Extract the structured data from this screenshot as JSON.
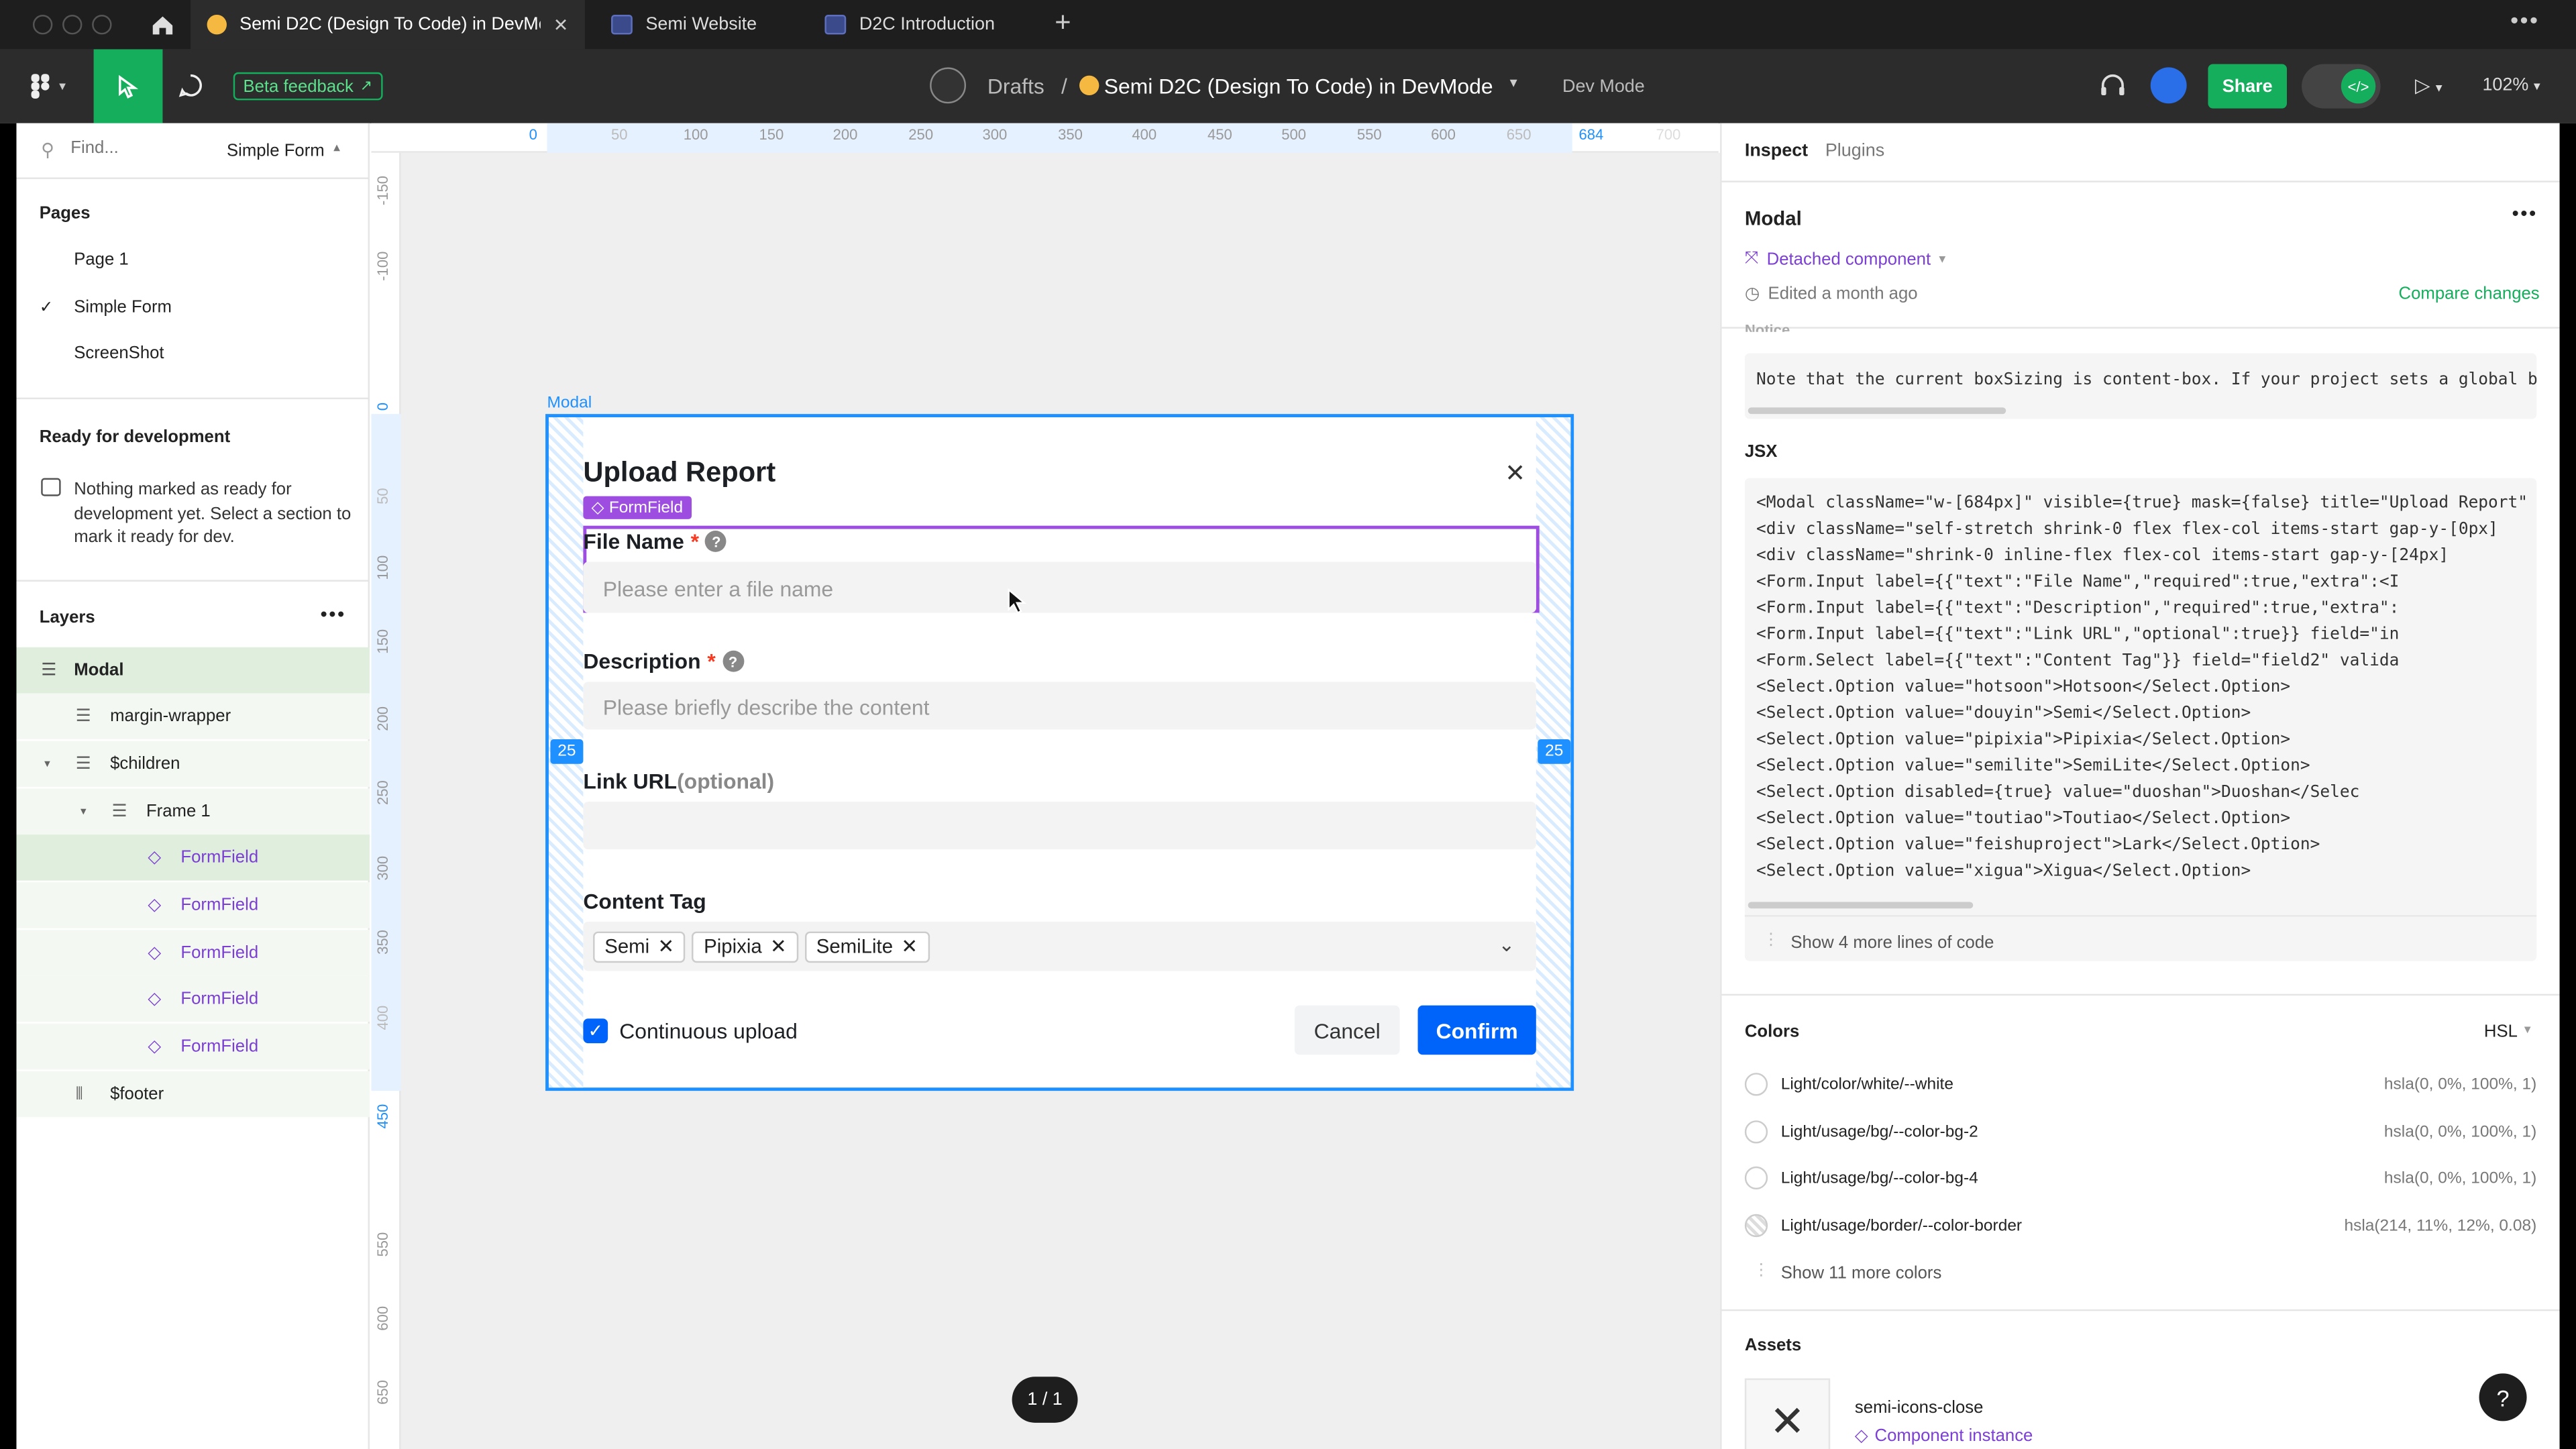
{
  "tabs": [
    {
      "label": "Semi D2C (Design To Code) in DevMod",
      "icon": "emoji-icon",
      "active": true
    },
    {
      "label": "Semi Website",
      "icon": "figma-file-icon",
      "active": false
    },
    {
      "label": "D2C Introduction",
      "icon": "figma-file-icon",
      "active": false
    }
  ],
  "toolbar": {
    "beta_feedback": "Beta feedback",
    "breadcrumb_root": "Drafts",
    "breadcrumb_sep": "/",
    "file_title": "Semi D2C (Design To Code) in DevMode",
    "mode": "Dev Mode",
    "share": "Share",
    "zoom": "102%"
  },
  "left_panel": {
    "search_placeholder": "Find...",
    "page_selector": "Simple Form",
    "pages_heading": "Pages",
    "pages": [
      "Page 1",
      "Simple Form",
      "ScreenShot"
    ],
    "ready_heading": "Ready for development",
    "ready_text": "Nothing marked as ready for development yet. Select a section to mark it ready for dev.",
    "layers_heading": "Layers",
    "layers": [
      {
        "label": "Modal"
      },
      {
        "label": "margin-wrapper"
      },
      {
        "label": "$children"
      },
      {
        "label": "Frame 1"
      },
      {
        "label": "FormField"
      },
      {
        "label": "FormField"
      },
      {
        "label": "FormField"
      },
      {
        "label": "FormField"
      },
      {
        "label": "FormField"
      },
      {
        "label": "$footer"
      }
    ]
  },
  "rulers": {
    "top": [
      "0",
      "50",
      "100",
      "150",
      "200",
      "250",
      "300",
      "350",
      "400",
      "450",
      "500",
      "550",
      "600",
      "650",
      "684",
      "700"
    ],
    "left": [
      "-150",
      "-100",
      "0",
      "50",
      "100",
      "150",
      "200",
      "250",
      "300",
      "350",
      "400",
      "450",
      "550",
      "600",
      "650"
    ]
  },
  "canvas": {
    "frame_label": "Modal",
    "spacing_badge": "25",
    "page_indicator": "1 / 1"
  },
  "modal": {
    "title": "Upload Report",
    "selection_tag": "FormField",
    "fields": [
      {
        "label": "File Name",
        "required": "*",
        "placeholder": "Please enter a file name"
      },
      {
        "label": "Description",
        "required": "*",
        "placeholder": "Please briefly describe the content"
      },
      {
        "label": "Link URL",
        "optional": "(optional)",
        "placeholder": ""
      },
      {
        "label": "Content Tag"
      }
    ],
    "tags": [
      "Semi",
      "Pipixia",
      "SemiLite"
    ],
    "checkbox_label": "Continuous upload",
    "cancel": "Cancel",
    "confirm": "Confirm"
  },
  "inspect": {
    "tabs": [
      "Inspect",
      "Plugins"
    ],
    "component_name": "Modal",
    "detached": "Detached component",
    "edited": "Edited a month ago",
    "compare": "Compare changes",
    "notice_heading": "Notice",
    "notice_text": "Note that the current boxSizing is content-box. If your project sets a global bo",
    "jsx_heading": "JSX",
    "code_lines": [
      "<Modal className=\"w-[684px]\" visible={true} mask={false} title=\"Upload Report\" f",
      "  <div className=\"self-stretch shrink-0 flex flex-col items-start gap-y-[0px]",
      "    <div className=\"shrink-0 inline-flex flex-col items-start gap-y-[24px]",
      "      <Form.Input label={{\"text\":\"File Name\",\"required\":true,\"extra\":<I",
      "      <Form.Input label={{\"text\":\"Description\",\"required\":true,\"extra\":",
      "      <Form.Input label={{\"text\":\"Link URL\",\"optional\":true}} field=\"in",
      "      <Form.Select label={{\"text\":\"Content Tag\"}} field=\"field2\" valida",
      "        <Select.Option value=\"hotsoon\">Hotsoon</Select.Option>",
      "        <Select.Option value=\"douyin\">Semi</Select.Option>",
      "        <Select.Option value=\"pipixia\">Pipixia</Select.Option>",
      "        <Select.Option value=\"semilite\">SemiLite</Select.Option>",
      "        <Select.Option disabled={true} value=\"duoshan\">Duoshan</Selec",
      "        <Select.Option value=\"toutiao\">Toutiao</Select.Option>",
      "        <Select.Option value=\"feishuproject\">Lark</Select.Option>",
      "        <Select.Option value=\"xigua\">Xigua</Select.Option>"
    ],
    "show_more_code": "Show 4 more lines of code",
    "colors_heading": "Colors",
    "color_format": "HSL",
    "colors": [
      {
        "name": "Light/color/white/--white",
        "value": "hsla(0, 0%, 100%, 1)",
        "hex": "#ffffff"
      },
      {
        "name": "Light/usage/bg/--color-bg-2",
        "value": "hsla(0, 0%, 100%, 1)",
        "hex": "#ffffff"
      },
      {
        "name": "Light/usage/bg/--color-bg-4",
        "value": "hsla(0, 0%, 100%, 1)",
        "hex": "#ffffff"
      },
      {
        "name": "Light/usage/border/--color-border",
        "value": "hsla(214, 11%, 12%, 0.08)",
        "hex": "#eeeff0"
      }
    ],
    "show_more_colors": "Show 11 more colors",
    "assets_heading": "Assets",
    "asset_name": "semi-icons-close",
    "asset_type": "Component instance",
    "help": "?"
  },
  "accent_colors": {
    "selection": "#1e90ff",
    "component": "#7b3fd4",
    "primary_button": "#0064fa",
    "share_button": "#14ae5c"
  }
}
